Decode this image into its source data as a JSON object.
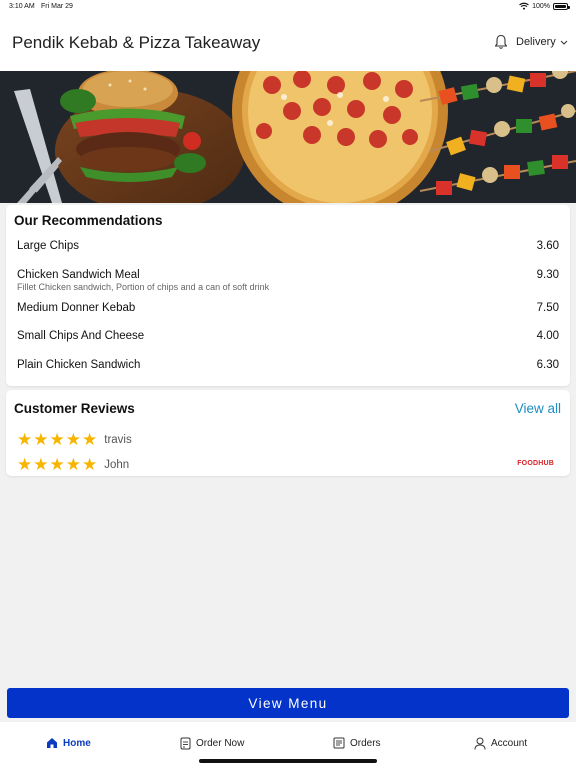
{
  "status_bar": {
    "time": "3:10 AM",
    "date": "Fri Mar 29",
    "battery": "100%"
  },
  "header": {
    "title": "Pendik Kebab & Pizza Takeaway",
    "delivery_label": "Delivery"
  },
  "recommendations": {
    "title": "Our Recommendations",
    "items": [
      {
        "name": "Large Chips",
        "description": "",
        "price": "3.60"
      },
      {
        "name": "Chicken Sandwich Meal",
        "description": "Fillet Chicken sandwich, Portion of chips and a can of soft drink",
        "price": "9.30"
      },
      {
        "name": "Medium Donner Kebab",
        "description": "",
        "price": "7.50"
      },
      {
        "name": "Small Chips And Cheese",
        "description": "",
        "price": "4.00"
      },
      {
        "name": "Plain Chicken Sandwich",
        "description": "",
        "price": "6.30"
      }
    ]
  },
  "reviews": {
    "title": "Customer Reviews",
    "view_all": "View all",
    "items": [
      {
        "name": "travis",
        "rating": 5
      },
      {
        "name": "John",
        "rating": 5
      }
    ],
    "brand": "FOODHUB"
  },
  "view_menu_label": "View Menu",
  "tabs": [
    {
      "label": "Home",
      "icon": "home-icon",
      "active": true
    },
    {
      "label": "Order Now",
      "icon": "order-icon",
      "active": false
    },
    {
      "label": "Orders",
      "icon": "receipt-icon",
      "active": false
    },
    {
      "label": "Account",
      "icon": "person-icon",
      "active": false
    }
  ],
  "colors": {
    "accent": "#0433c9",
    "link": "#1b8ec2",
    "star": "#f7b500",
    "brand_red": "#d8232a"
  }
}
